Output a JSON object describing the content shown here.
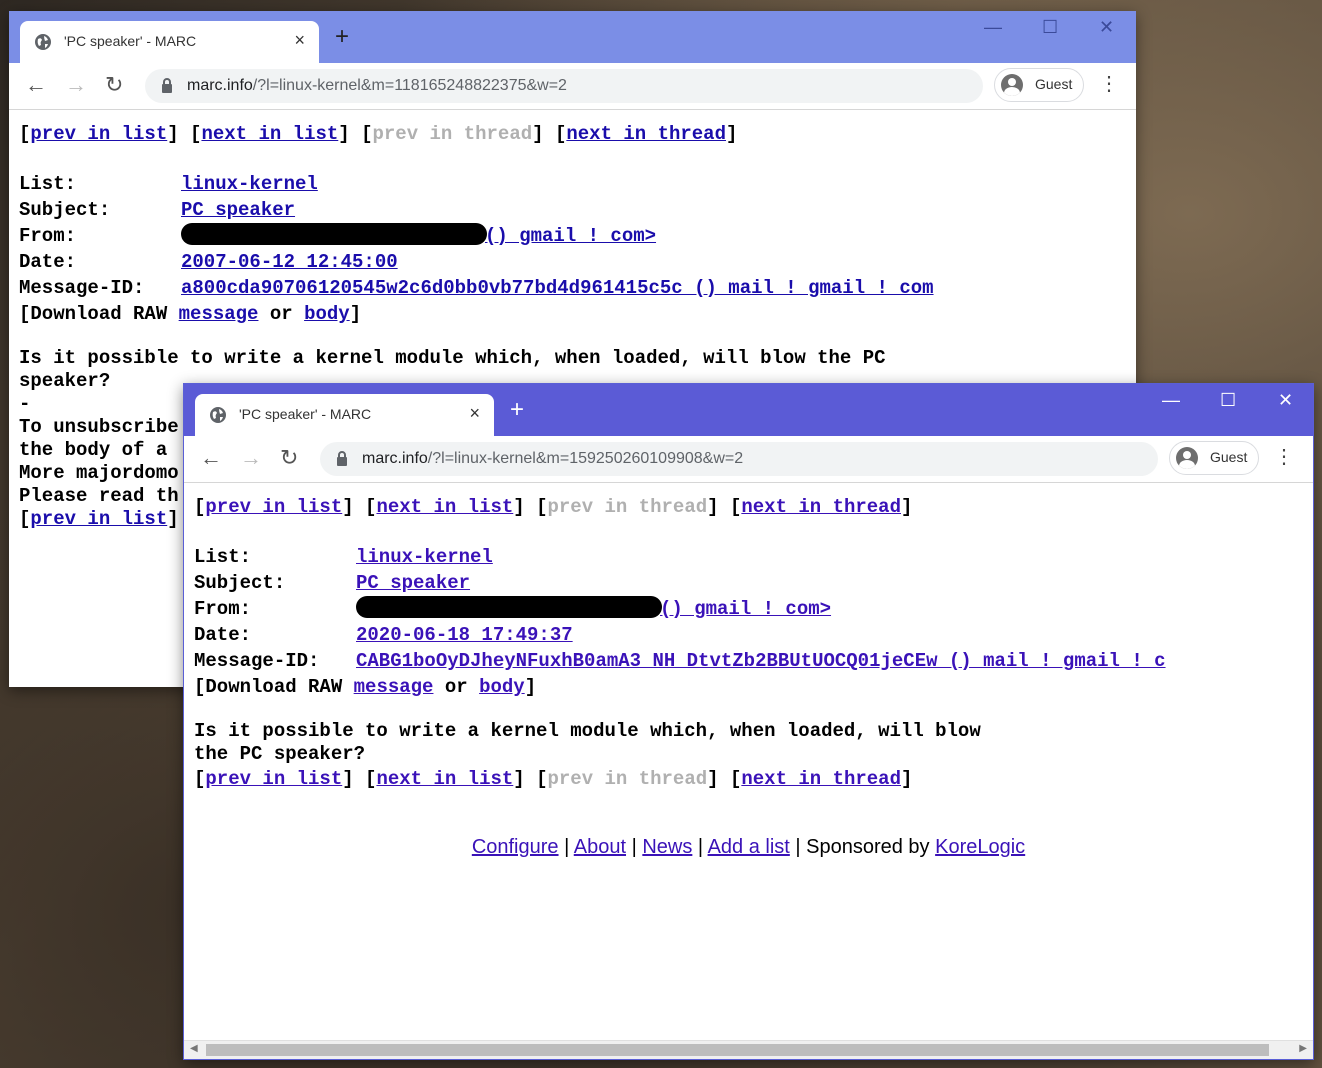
{
  "windows": [
    {
      "tab_title": "'PC speaker' - MARC",
      "new_tab": "+",
      "url_host": "marc.info",
      "url_rest": "/?l=linux-kernel&m=118165248822375&w=2",
      "profile": "Guest",
      "nav": {
        "prev_list": "prev in list",
        "next_list": "next in list",
        "prev_thread": "prev in thread",
        "next_thread": "next in thread"
      },
      "headers": {
        "list_label": "List:",
        "list_value": "linux-kernel",
        "subject_label": "Subject:",
        "subject_value": "PC speaker",
        "from_label": "From:",
        "from_value": "() gmail ! com>",
        "date_label": "Date:",
        "date_value": "2007-06-12 12:45:00",
        "msgid_label": "Message-ID:",
        "msgid_value": "a800cda90706120545w2c6d0bb0vb77bd4d961415c5c () mail ! gmail ! com"
      },
      "download": {
        "prefix": "[Download RAW ",
        "message": "message",
        "or": " or ",
        "body": "body",
        "suffix": "]"
      },
      "body_lines": [
        "Is it possible to write a kernel module which, when loaded, will blow the PC",
        "speaker?",
        "-",
        "To unsubscribe",
        "the body of a",
        "More majordomo",
        "Please read th"
      ],
      "bottom_prev_list": "prev in list"
    },
    {
      "tab_title": "'PC speaker' - MARC",
      "new_tab": "+",
      "url_host": "marc.info",
      "url_rest": "/?l=linux-kernel&m=159250260109908&w=2",
      "profile": "Guest",
      "nav": {
        "prev_list": "prev in list",
        "next_list": "next in list",
        "prev_thread": "prev in thread",
        "next_thread": "next in thread"
      },
      "headers": {
        "list_label": "List:",
        "list_value": "linux-kernel",
        "subject_label": "Subject:",
        "subject_value": "PC speaker",
        "from_label": "From:",
        "from_value": "() gmail ! com>",
        "date_label": "Date:",
        "date_value": "2020-06-18 17:49:37",
        "msgid_label": "Message-ID:",
        "msgid_value": "CABG1boOyDJheyNFuxhB0amA3_NH_DtvtZb2BBUtUOCQ01jeCEw () mail ! gmail ! c"
      },
      "download": {
        "prefix": "[Download RAW ",
        "message": "message",
        "or": " or ",
        "body": "body",
        "suffix": "]"
      },
      "body_lines": [
        "Is it possible to write a kernel module which, when loaded, will blow",
        "the PC speaker?"
      ],
      "footer": {
        "configure": "Configure",
        "about": "About",
        "news": "News",
        "add_list": "Add a list",
        "sponsored": "Sponsored by",
        "sponsor": "KoreLogic",
        "sep": " | "
      }
    }
  ],
  "colors": {
    "win1_titlebar": "#7b8ee6",
    "win2_titlebar": "#5b5bd6",
    "link": "#1a0dab"
  }
}
